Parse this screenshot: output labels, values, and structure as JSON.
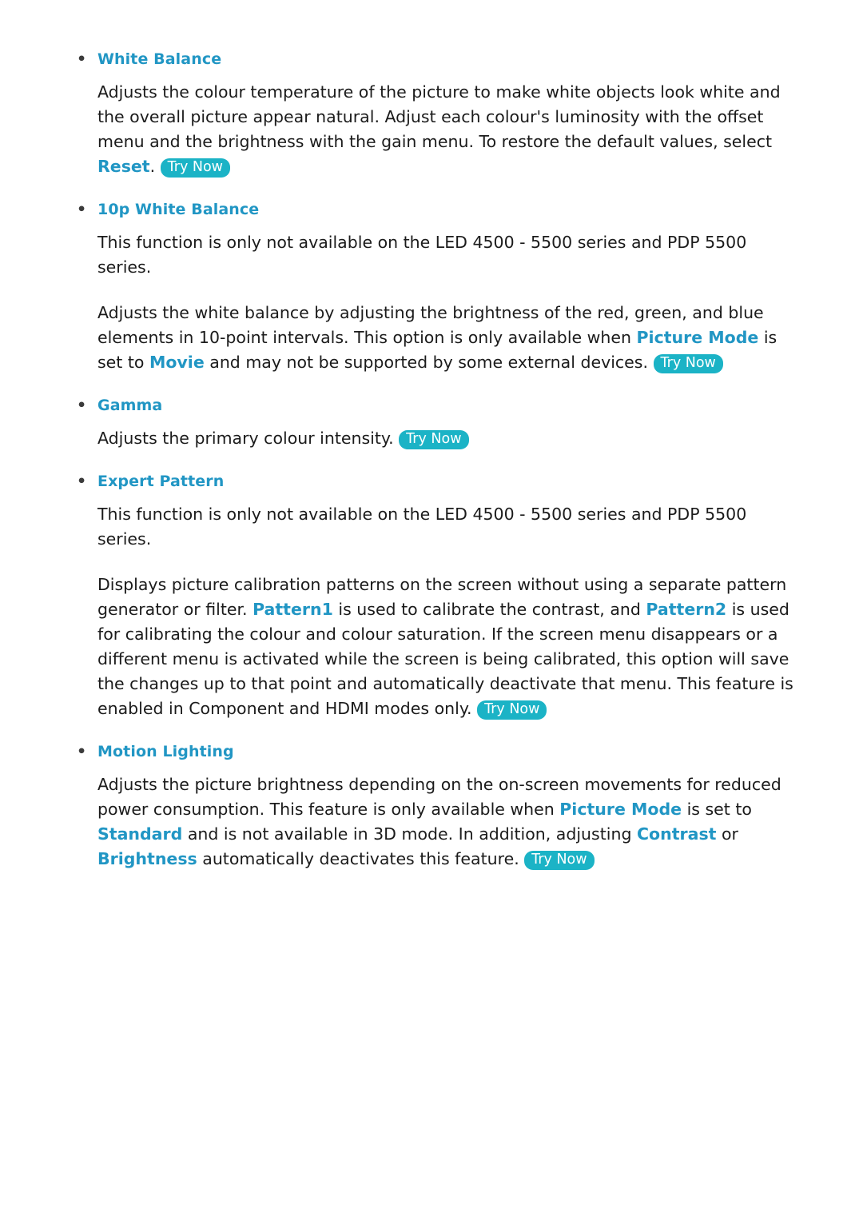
{
  "document": {
    "bullet_glyph": "•",
    "try_now_label": "Try Now",
    "sections": [
      {
        "id": "white-balance",
        "heading": "White Balance",
        "paragraphs": [
          {
            "id": "white-balance-p1",
            "parts": [
              {
                "type": "text",
                "text": "Adjusts the colour temperature of the picture to make white objects look white and the overall picture appear natural. Adjust each colour's luminosity with the offset menu and the brightness with the gain menu. To restore the default values, select "
              },
              {
                "type": "keyword",
                "text": "Reset"
              },
              {
                "type": "text",
                "text": ". "
              },
              {
                "type": "badge",
                "text": "Try Now"
              }
            ]
          }
        ]
      },
      {
        "id": "10p-white-balance",
        "heading": "10p White Balance",
        "paragraphs": [
          {
            "id": "10p-white-balance-p1",
            "parts": [
              {
                "type": "text",
                "text": "This function is only not available on the LED 4500 - 5500 series and PDP 5500 series."
              }
            ]
          },
          {
            "id": "10p-white-balance-p2",
            "parts": [
              {
                "type": "text",
                "text": "Adjusts the white balance by adjusting the brightness of the red, green, and blue elements in 10-point intervals. This option is only available when "
              },
              {
                "type": "keyword",
                "text": "Picture Mode"
              },
              {
                "type": "text",
                "text": " is set to "
              },
              {
                "type": "keyword",
                "text": "Movie"
              },
              {
                "type": "text",
                "text": " and may not be supported by some external devices. "
              },
              {
                "type": "badge",
                "text": "Try Now"
              }
            ]
          }
        ]
      },
      {
        "id": "gamma",
        "heading": "Gamma",
        "paragraphs": [
          {
            "id": "gamma-p1",
            "parts": [
              {
                "type": "text",
                "text": "Adjusts the primary colour intensity. "
              },
              {
                "type": "badge",
                "text": "Try Now"
              }
            ]
          }
        ]
      },
      {
        "id": "expert-pattern",
        "heading": "Expert Pattern",
        "paragraphs": [
          {
            "id": "expert-pattern-p1",
            "parts": [
              {
                "type": "text",
                "text": "This function is only not available on the LED 4500 - 5500 series and PDP 5500 series."
              }
            ]
          },
          {
            "id": "expert-pattern-p2",
            "parts": [
              {
                "type": "text",
                "text": "Displays picture calibration patterns on the screen without using a separate pattern generator or filter. "
              },
              {
                "type": "keyword",
                "text": "Pattern1"
              },
              {
                "type": "text",
                "text": " is used to calibrate the contrast, and "
              },
              {
                "type": "keyword",
                "text": "Pattern2"
              },
              {
                "type": "text",
                "text": " is used for calibrating the colour and colour saturation. If the screen menu disappears or a different menu is activated while the screen is being calibrated, this option will save the changes up to that point and automatically deactivate that menu. This feature is enabled in Component and HDMI modes only. "
              },
              {
                "type": "badge",
                "text": "Try Now"
              }
            ]
          }
        ]
      },
      {
        "id": "motion-lighting",
        "heading": "Motion Lighting",
        "paragraphs": [
          {
            "id": "motion-lighting-p1",
            "parts": [
              {
                "type": "text",
                "text": "Adjusts the picture brightness depending on the on-screen movements for reduced power consumption. This feature is only available when "
              },
              {
                "type": "keyword",
                "text": "Picture Mode"
              },
              {
                "type": "text",
                "text": " is set to "
              },
              {
                "type": "keyword",
                "text": "Standard"
              },
              {
                "type": "text",
                "text": " and is not available in 3D mode. In addition, adjusting "
              },
              {
                "type": "keyword",
                "text": "Contrast"
              },
              {
                "type": "text",
                "text": " or "
              },
              {
                "type": "keyword",
                "text": "Brightness"
              },
              {
                "type": "text",
                "text": " automatically deactivates this feature. "
              },
              {
                "type": "badge",
                "text": "Try Now"
              }
            ]
          }
        ]
      }
    ]
  },
  "colors": {
    "accent": "#2196c4",
    "badge_bg": "#1bb3c6",
    "text": "#1b1b1b"
  }
}
